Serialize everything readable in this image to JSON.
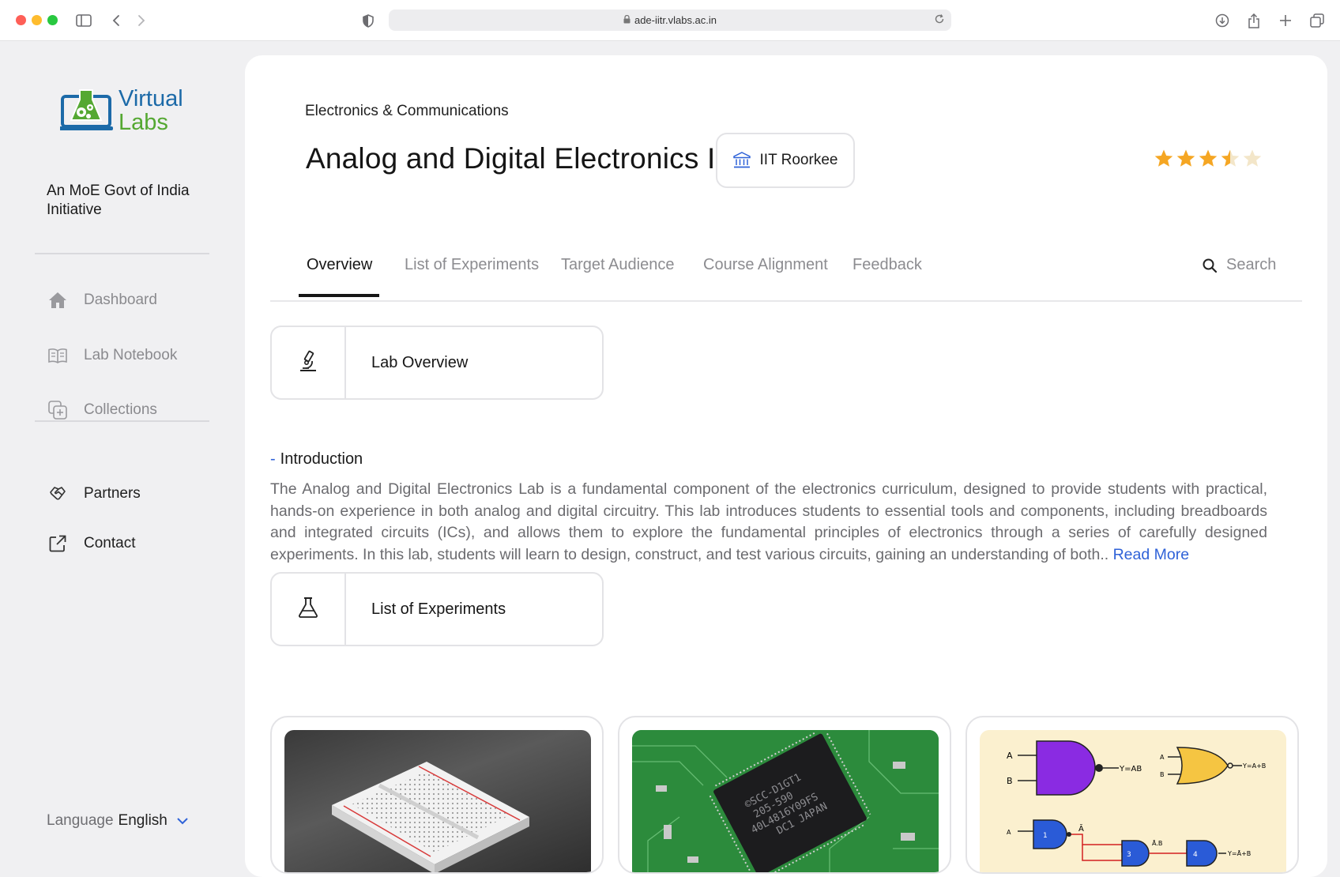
{
  "browser": {
    "url": "ade-iitr.vlabs.ac.in"
  },
  "sidebar": {
    "logo": {
      "line1": "Virtual",
      "line2": "Labs"
    },
    "initiative": "An MoE Govt of India Initiative",
    "nav": [
      {
        "label": "Dashboard",
        "icon": "home-icon"
      },
      {
        "label": "Lab Notebook",
        "icon": "notebook-icon"
      },
      {
        "label": "Collections",
        "icon": "collections-icon"
      }
    ],
    "secondary": [
      {
        "label": "Partners",
        "icon": "handshake-icon"
      },
      {
        "label": "Contact",
        "icon": "external-link-icon"
      }
    ],
    "language": {
      "label": "Language",
      "value": "English"
    }
  },
  "header": {
    "category": "Electronics & Communications",
    "title": "Analog and Digital Electronics I",
    "institute": "IIT Roorkee",
    "rating": 3.5,
    "rating_max": 5
  },
  "tabs": [
    {
      "label": "Overview",
      "active": true
    },
    {
      "label": "List of Experiments",
      "active": false
    },
    {
      "label": "Target Audience",
      "active": false
    },
    {
      "label": "Course Alignment",
      "active": false
    },
    {
      "label": "Feedback",
      "active": false
    }
  ],
  "search": {
    "label": "Search"
  },
  "overview": {
    "section_title": "Lab Overview",
    "intro_heading": "Introduction",
    "intro_text": "The Analog and Digital Electronics Lab is a fundamental component of the electronics curriculum, designed to provide students with practical, hands-on experience in both analog and digital circuitry. This lab introduces students to essential tools and components, including breadboards and integrated circuits (ICs), and allows them to explore the fundamental principles of electronics through a series of carefully designed experiments. In this lab, students will learn to design, construct, and test various circuits, gaining an understanding of both..",
    "read_more": "Read More"
  },
  "experiments": {
    "section_title": "List of Experiments",
    "cards": [
      {
        "image": "breadboard-image"
      },
      {
        "image": "ic-chip-image",
        "chip_text": [
          "©SCC-D1GT1",
          "205-590",
          "40L4816Y09FS",
          "DC1 JAPAN"
        ]
      },
      {
        "image": "logic-gates-image",
        "labels": [
          "A",
          "B",
          "Y=AB",
          "A",
          "B",
          "Y=A+B",
          "A",
          "1",
          "Ā",
          "3",
          "Ā.B",
          "4",
          "Y=Ā+B"
        ]
      }
    ]
  },
  "colors": {
    "accent": "#2f62d8",
    "star": "#f5a623",
    "logo_blue": "#1c6aa8",
    "logo_green": "#54a832"
  }
}
